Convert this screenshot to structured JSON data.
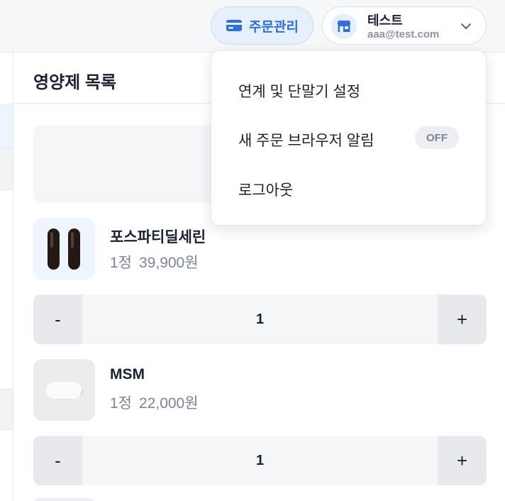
{
  "header": {
    "order_button_label": "주문관리",
    "account": {
      "name": "테스트",
      "email": "aaa@test.com"
    }
  },
  "panel": {
    "title": "영양제 목록",
    "items": [
      {
        "name": "포스파티딜세린",
        "unit": "1정",
        "price": "39,900원",
        "quantity": "1"
      },
      {
        "name": "MSM",
        "unit": "1정",
        "price": "22,000원",
        "quantity": "1"
      }
    ],
    "stepper": {
      "minus_label": "-",
      "plus_label": "+"
    }
  },
  "dropdown": {
    "items": [
      {
        "label": "연계 및 단말기 설정"
      },
      {
        "label": "새 주문 브라우저 알림",
        "toggle": "OFF"
      },
      {
        "label": "로그아웃"
      }
    ]
  },
  "colors": {
    "accent": "#2f6fd6",
    "accent_bg": "#e6f0fd",
    "text": "#1b2130",
    "muted": "#7b8494"
  },
  "icons": {
    "order_button": "credit-card-icon",
    "account": "store-icon",
    "account_toggle": "chevron-down-icon"
  }
}
